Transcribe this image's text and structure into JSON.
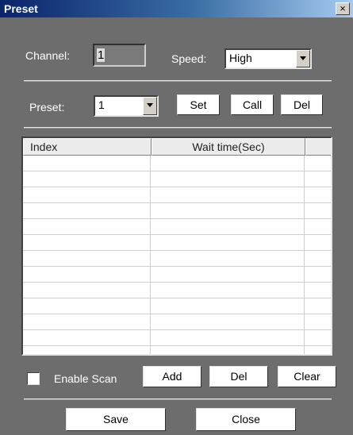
{
  "window": {
    "title": "Preset",
    "close_glyph": "×"
  },
  "channel": {
    "label": "Channel:",
    "value": "1"
  },
  "speed": {
    "label": "Speed:",
    "value": "High"
  },
  "preset": {
    "label": "Preset:",
    "value": "1"
  },
  "preset_buttons": {
    "set": "Set",
    "call": "Call",
    "del": "Del"
  },
  "table": {
    "columns": [
      "Index",
      "Wait time(Sec)",
      ""
    ],
    "rows": []
  },
  "scan": {
    "enable_label": "Enable Scan",
    "checked": false
  },
  "scan_buttons": {
    "add": "Add",
    "del": "Del",
    "clear": "Clear"
  },
  "footer": {
    "save": "Save",
    "close": "Close"
  }
}
